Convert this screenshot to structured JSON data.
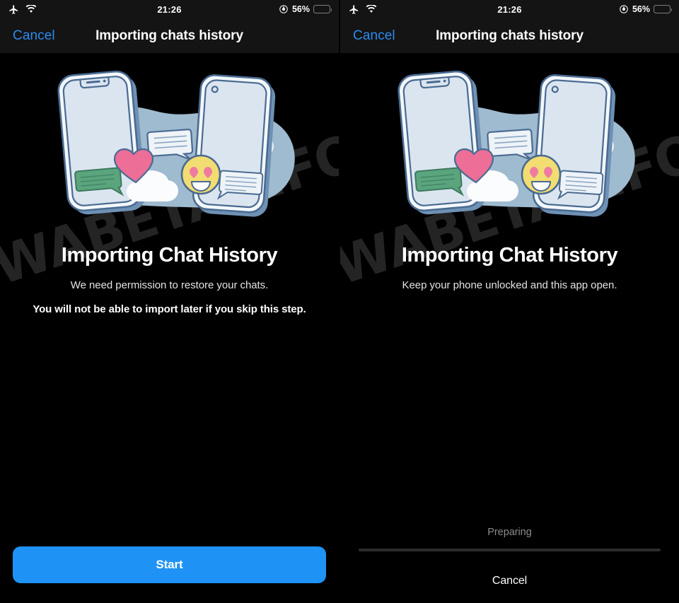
{
  "colors": {
    "accent_blue": "#1f93f5",
    "nav_link_blue": "#2b8cf0",
    "battery_yellow": "#fcd11a",
    "background": "#000000",
    "bar_background": "#141414",
    "watermark": "#242424",
    "illustration_blob": "#9fbbd0",
    "illustration_phone": "#dbe5f0",
    "illustration_stroke": "#4a6b91",
    "heart_pink": "#ed6e96",
    "emoji_yellow": "#f2dd72",
    "bubble_green": "#5aa47e",
    "cloud_white": "#f5f7fa",
    "progress_track": "#2c2c2e"
  },
  "watermark": {
    "text": "CWABETAINFO"
  },
  "panels": [
    {
      "id": "permission-step",
      "status_bar": {
        "airplane_icon": "airplane-mode-icon",
        "wifi_icon": "wifi-icon",
        "time": "21:26",
        "lock_icon": "rotation-lock-icon",
        "battery_percent": "56%",
        "battery_level": 56
      },
      "nav": {
        "cancel_label": "Cancel",
        "title": "Importing chats history"
      },
      "illustration": "two-phones-chat-transfer-illustration",
      "title": "Importing Chat History",
      "subtitle": "We need permission to restore your chats.",
      "warning": "You will not be able to import later if you skip this step.",
      "primary_button": {
        "label": "Start"
      }
    },
    {
      "id": "progress-step",
      "status_bar": {
        "airplane_icon": "airplane-mode-icon",
        "wifi_icon": "wifi-icon",
        "time": "21:26",
        "lock_icon": "rotation-lock-icon",
        "battery_percent": "56%",
        "battery_level": 56
      },
      "nav": {
        "cancel_label": "Cancel",
        "title": "Importing chats history"
      },
      "illustration": "two-phones-chat-transfer-illustration",
      "title": "Importing Chat History",
      "subtitle": "Keep your phone unlocked and this app open.",
      "progress": {
        "label": "Preparing",
        "percent": 0
      },
      "cancel_action_label": "Cancel"
    }
  ]
}
